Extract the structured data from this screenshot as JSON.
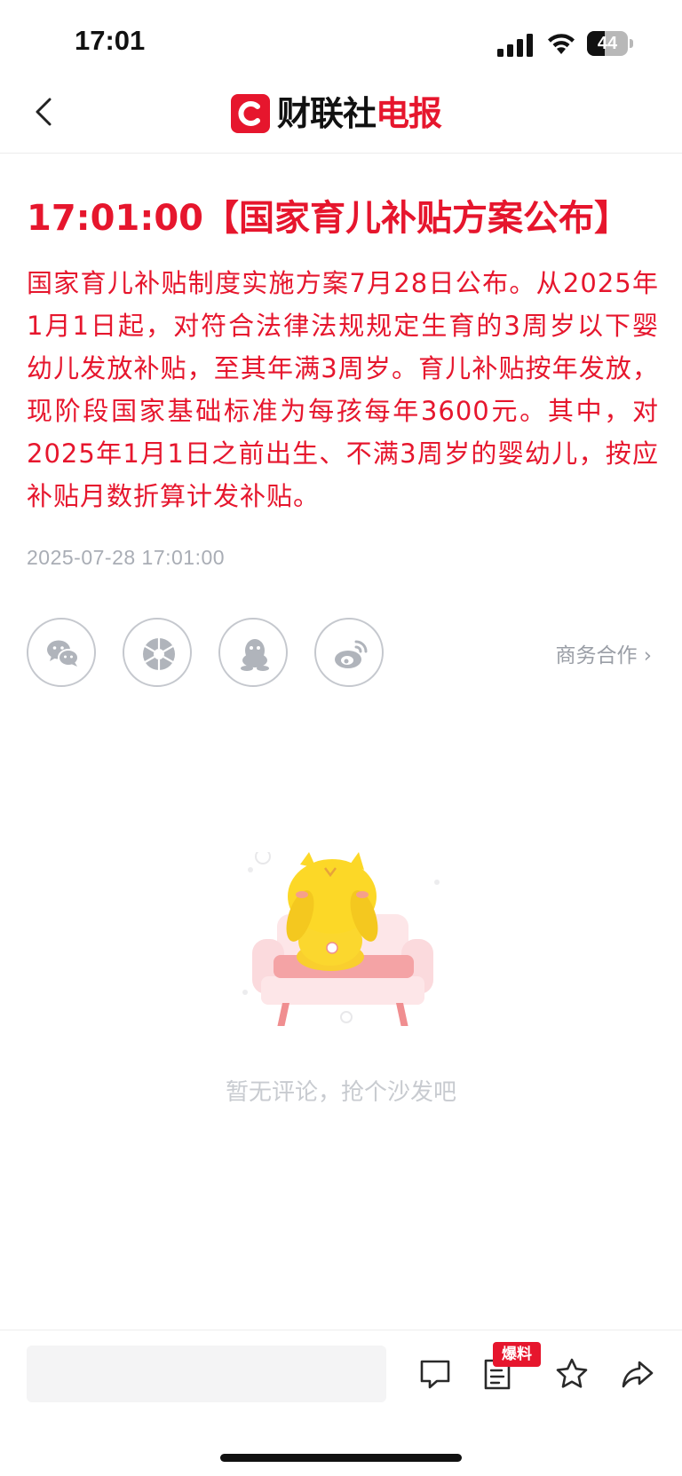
{
  "status_bar": {
    "time": "17:01",
    "battery_level": "44",
    "battery_fraction": 0.44
  },
  "nav": {
    "back_icon": "chevron-left-icon",
    "logo_mark": "C",
    "logo_text_black": "财联社",
    "logo_text_red": "电报"
  },
  "article": {
    "headline": "17:01:00【国家育儿补贴方案公布】",
    "body": "国家育儿补贴制度实施方案7月28日公布。从2025年1月1日起，对符合法律法规规定生育的3周岁以下婴幼儿发放补贴，至其年满3周岁。育儿补贴按年发放，现阶段国家基础标准为每孩每年3600元。其中，对2025年1月1日之前出生、不满3周岁的婴幼儿，按应补贴月数折算计发补贴。",
    "timestamp": "2025-07-28 17:01:00"
  },
  "share": {
    "icons": [
      "wechat-icon",
      "moments-icon",
      "qq-icon",
      "weibo-icon"
    ],
    "business_link": "商务合作 ›"
  },
  "comments": {
    "empty_message": "暂无评论，抢个沙发吧"
  },
  "bottom_bar": {
    "input_placeholder": "",
    "badge": "爆料",
    "icons": [
      "comment-icon",
      "report-icon",
      "star-icon",
      "share-icon"
    ]
  },
  "colors": {
    "brand_red": "#e6162d",
    "muted_gray": "#a9adb5"
  }
}
